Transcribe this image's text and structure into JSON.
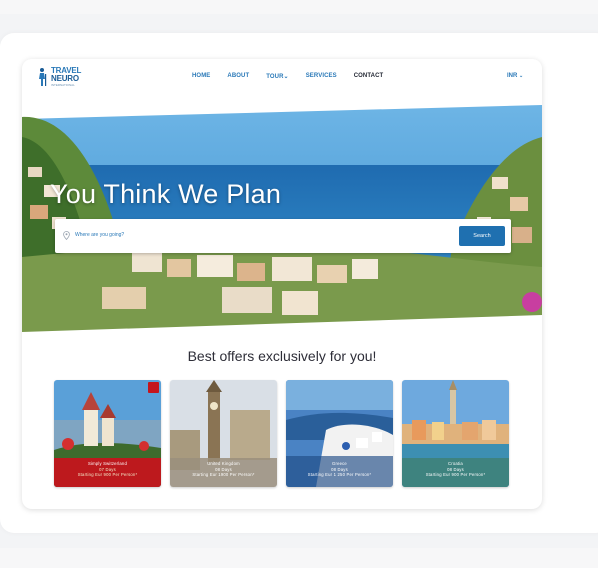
{
  "nav": {
    "logo_line1": "TRAVEL",
    "logo_line2": "NEURO",
    "logo_line3": "INTERNATIONAL",
    "items": [
      {
        "label": "HOME"
      },
      {
        "label": "ABOUT"
      },
      {
        "label": "TOUR"
      },
      {
        "label": "SERVICES"
      },
      {
        "label": "CONTACT"
      }
    ],
    "currency": "INR"
  },
  "hero": {
    "title": "You Think We Plan",
    "search_placeholder": "Where are you going?",
    "search_button": "Search"
  },
  "offers": {
    "title": "Best offers exclusively for you!",
    "cards": [
      {
        "line1": "Simply Switzerland",
        "line2": "07 Days",
        "line3": "Starting Eur 900 Per Person*",
        "theme": "switzerland"
      },
      {
        "line1": "United Kingdom",
        "line2": "08 Days",
        "line3": "Starting Eur 1900 Per Person*",
        "theme": "london"
      },
      {
        "line1": "Greece",
        "line2": "08 Days",
        "line3": "Starting Eur 1 250 Per Person*",
        "theme": "greece"
      },
      {
        "line1": "Croatia",
        "line2": "08 Days",
        "line3": "Starting Eur 900 Per Person*",
        "theme": "croatia"
      }
    ]
  },
  "colors": {
    "brand_blue": "#2a79b8",
    "button_blue": "#1f70b0",
    "card1_red": "#c4151c"
  }
}
